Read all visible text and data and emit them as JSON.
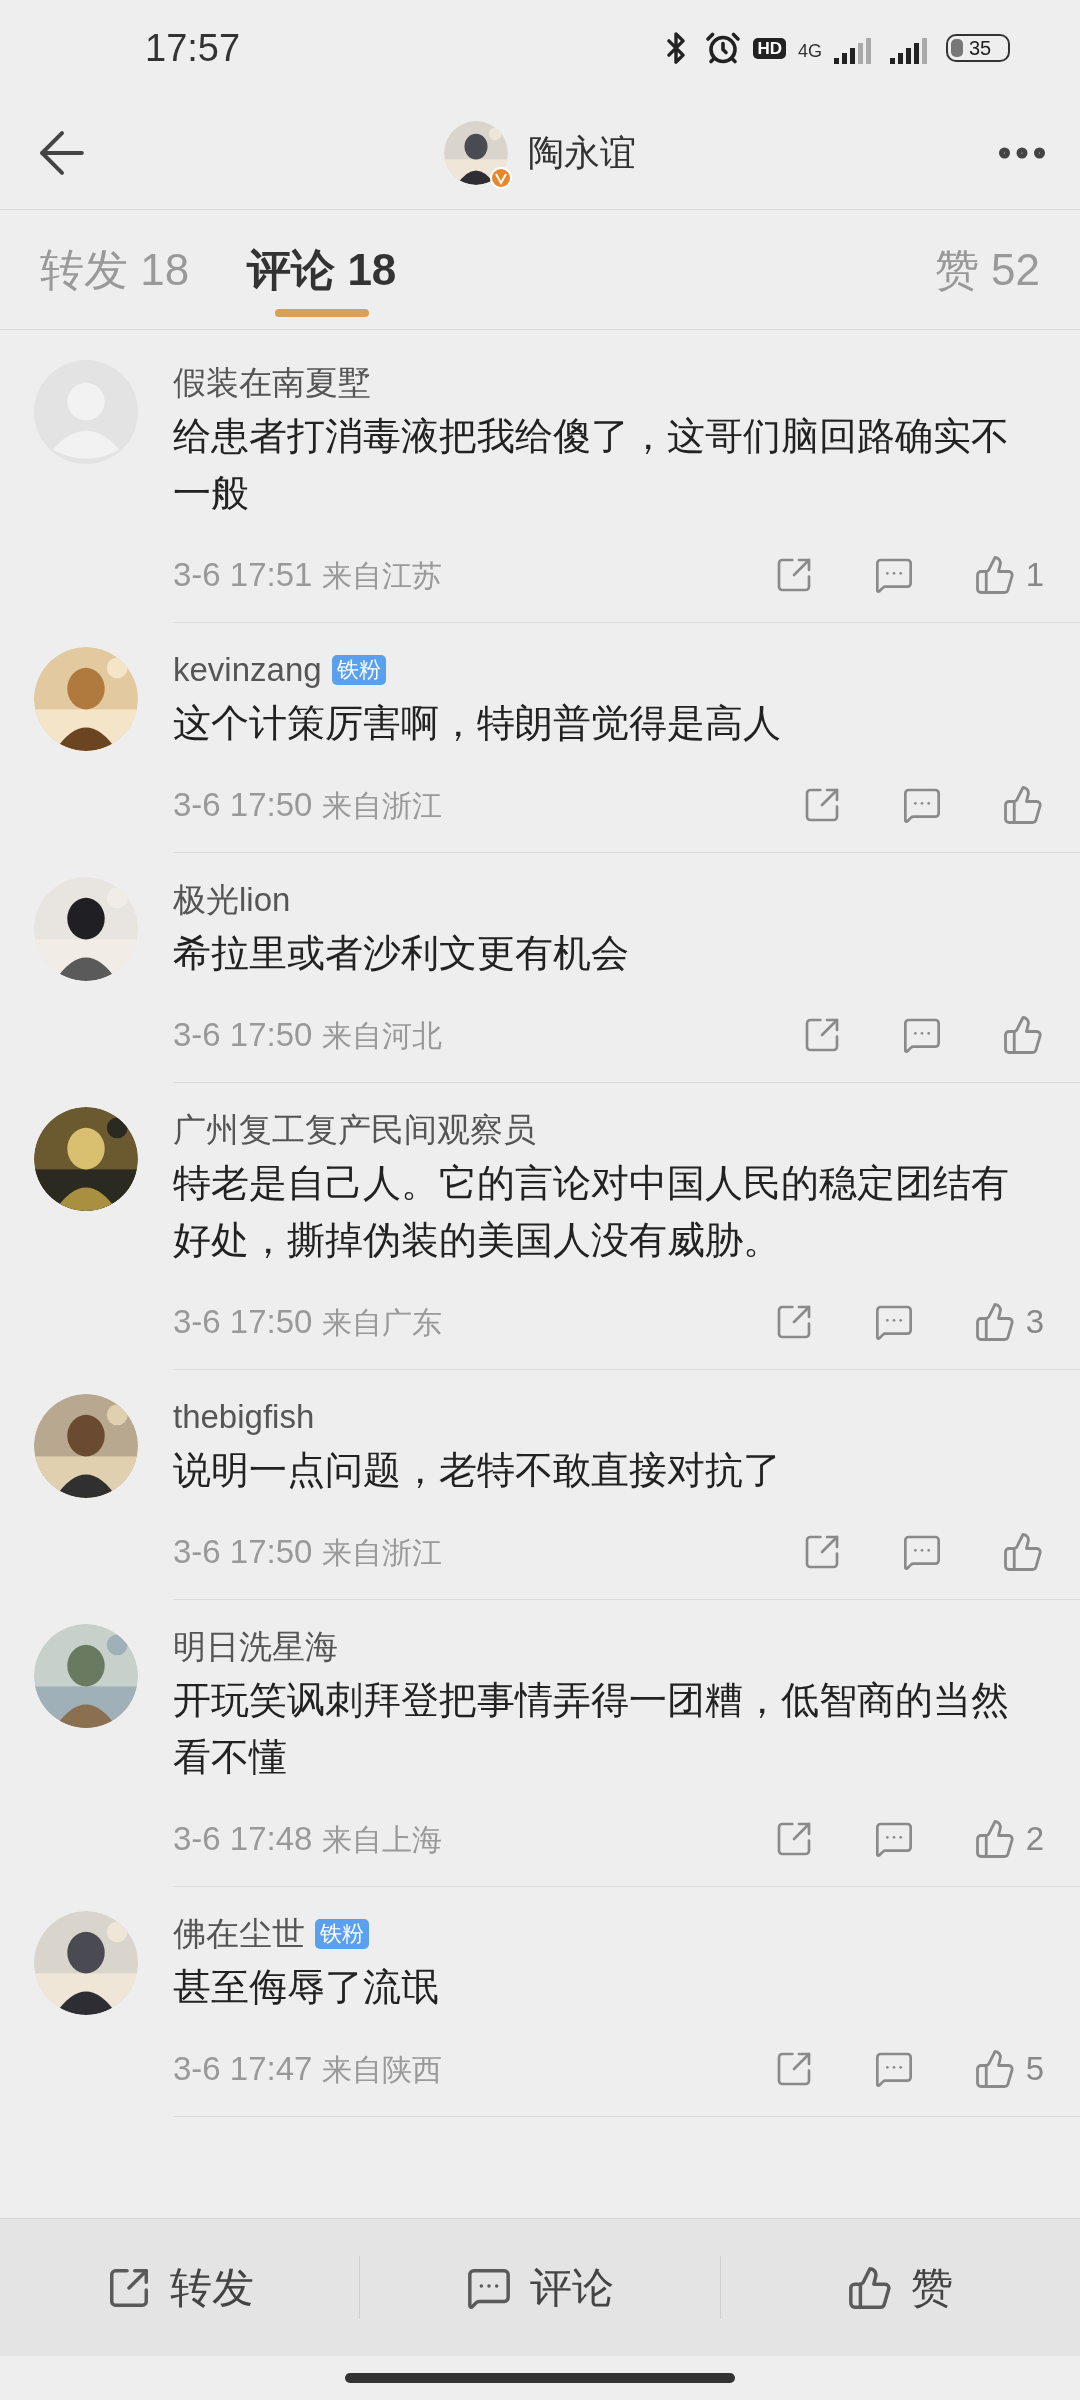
{
  "status_bar": {
    "time": "17:57",
    "hd": "HD",
    "network": "4G",
    "battery": "35"
  },
  "header": {
    "title": "陶永谊"
  },
  "tabs": [
    {
      "label": "转发 18",
      "selected": false
    },
    {
      "label": "评论 18",
      "selected": true
    },
    {
      "label": "赞 52",
      "selected": false
    }
  ],
  "comments": [
    {
      "user": "假装在南夏墅",
      "avatar": {
        "kind": "default"
      },
      "body": "给患者打消毒液把我给傻了，这哥们脑回路确实不一般",
      "time": "3-6 17:51",
      "location": "来自江苏",
      "likes": "1"
    },
    {
      "user": "kevinzang",
      "badge": "铁粉",
      "body": "这个计策厉害啊，特朗普觉得是高人",
      "time": "3-6 17:50",
      "location": "来自浙江"
    },
    {
      "user": "极光lion",
      "body": "希拉里或者沙利文更有机会",
      "time": "3-6 17:50",
      "location": "来自河北"
    },
    {
      "user": "广州复工复产民间观察员",
      "body": "特老是自己人。它的言论对中国人民的稳定团结有好处，撕掉伪装的美国人没有威胁。",
      "time": "3-6 17:50",
      "location": "来自广东",
      "likes": "3"
    },
    {
      "user": "thebigfish",
      "body": "说明一点问题，老特不敢直接对抗了",
      "time": "3-6 17:50",
      "location": "来自浙江"
    },
    {
      "user": "明日洗星海",
      "body": "开玩笑讽刺拜登把事情弄得一团糟，低智商的当然看不懂",
      "time": "3-6 17:48",
      "location": "来自上海",
      "likes": "2"
    },
    {
      "user": "佛在尘世",
      "badge": "铁粉",
      "body": "甚至侮辱了流氓",
      "time": "3-6 17:47",
      "location": "来自陕西",
      "likes": "5"
    }
  ],
  "bottom_bar": [
    {
      "label": "转发",
      "kind": "share"
    },
    {
      "label": "评论",
      "kind": "comment"
    },
    {
      "label": "赞",
      "kind": "like"
    }
  ]
}
